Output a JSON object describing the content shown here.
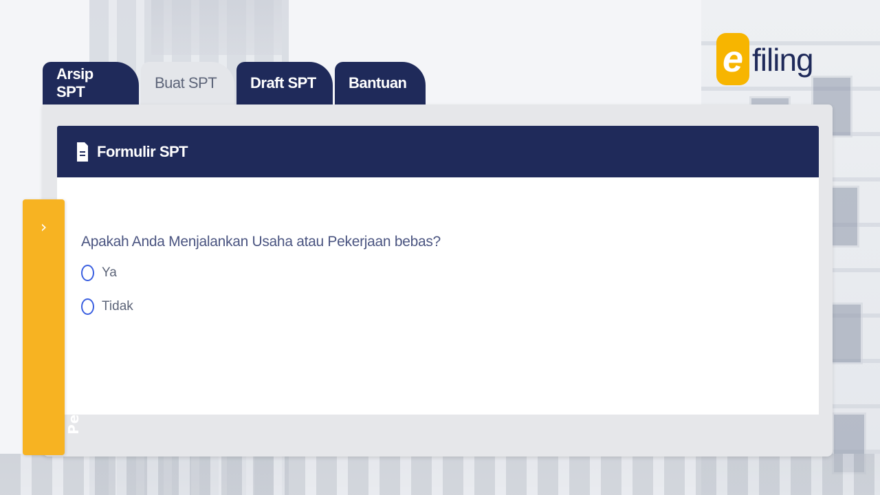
{
  "logo": {
    "badge_letter": "e",
    "text": "filing"
  },
  "tabs": [
    {
      "label": "Arsip SPT",
      "active": false
    },
    {
      "label": "Buat SPT",
      "active": true
    },
    {
      "label": "Draft SPT",
      "active": false
    },
    {
      "label": "Bantuan",
      "active": false
    }
  ],
  "panel": {
    "icon": "document-icon",
    "title": "Formulir SPT"
  },
  "form": {
    "question": "Apakah Anda Menjalankan Usaha atau Pekerjaan bebas?",
    "options": [
      {
        "label": "Ya",
        "selected": false
      },
      {
        "label": "Tidak",
        "selected": false
      }
    ]
  },
  "side_panel": {
    "chevron": "›",
    "label": "Petunjuk Pengisian"
  },
  "colors": {
    "navy": "#1f2a5a",
    "accent_yellow": "#f7b322",
    "radio_blue": "#3a5fe0"
  }
}
